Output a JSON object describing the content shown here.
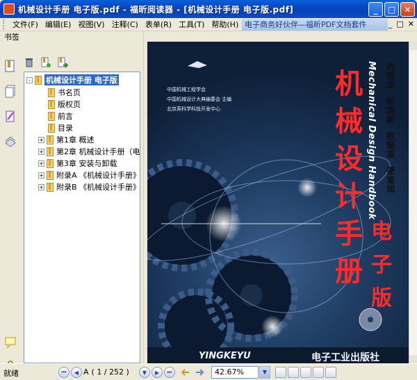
{
  "window": {
    "title": "机械设计手册 电子版.pdf - 福昕阅读器 - [机械设计手册 电子版.pdf]",
    "buttons": {
      "minimize": "_",
      "maximize": "□",
      "close": "✕"
    }
  },
  "menubar": {
    "items": [
      "文件(F)",
      "编辑(E)",
      "视图(V)",
      "注释(C)",
      "表单(R)",
      "工具(T)",
      "帮助(H)"
    ],
    "promo": "电子商务好伙伴—福昕PDF文档套件",
    "mdi": [
      "_",
      "□",
      "✕"
    ]
  },
  "bookmarks_panel": {
    "header": "书签",
    "toolbar_icons": [
      "delete-icon",
      "bookmark-add-icon",
      "bookmark-go-icon"
    ],
    "side_icons": [
      "bookmarks-icon",
      "pages-icon",
      "layers-icon",
      "attachments-icon",
      "comments-icon",
      "paperclip-icon"
    ],
    "tree": [
      {
        "label": "机械设计手册 电子版",
        "expander": "-",
        "level": 0,
        "selected": true
      },
      {
        "label": "书名页",
        "expander": "",
        "level": 1
      },
      {
        "label": "版权页",
        "expander": "",
        "level": 1
      },
      {
        "label": "前言",
        "expander": "",
        "level": 1
      },
      {
        "label": "目录",
        "expander": "",
        "level": 1
      },
      {
        "label": "第1章  概述",
        "expander": "+",
        "level": 1
      },
      {
        "label": "第2章  机械设计手册（电",
        "expander": "+",
        "level": 1
      },
      {
        "label": "第3章  安装与卸载",
        "expander": "+",
        "level": 1
      },
      {
        "label": "附录A  《机械设计手册》",
        "expander": "+",
        "level": 1
      },
      {
        "label": "附录B  《机械设计手册》",
        "expander": "+",
        "level": 1
      }
    ]
  },
  "cover": {
    "publisher_lines": [
      "中国机械工程学会",
      "中国机械设计大典编委会  主编",
      "北京英科学科技开发中心"
    ],
    "title_chars": [
      "机",
      "械",
      "设",
      "计",
      "手",
      "册"
    ],
    "english_title": "Mechanical Design Handbook",
    "subtitle_cols": [
      "内容全",
      "标准新",
      "数据准",
      "便查阅"
    ],
    "edition": "电子版",
    "brand": "YINGKEYU",
    "press": "电子工业出版社"
  },
  "statusbar": {
    "status": "就绪",
    "page_label": "A",
    "page_current": "( 1 / 252 )",
    "zoom": "42.67%"
  },
  "colors": {
    "title_bar": "#0a4ec8",
    "cover_title": "#ff2a2a",
    "cover_bg": "#1f3d63",
    "selection": "#316ac5"
  }
}
